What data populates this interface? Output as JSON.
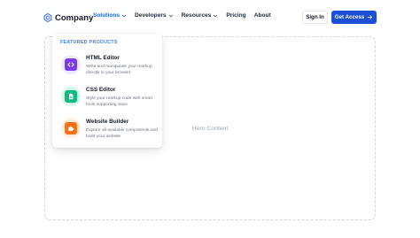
{
  "brand": {
    "name": "Company",
    "accent": "#2563eb"
  },
  "nav": {
    "items": [
      {
        "label": "Solutions",
        "has_dropdown": true,
        "active": true
      },
      {
        "label": "Developers",
        "has_dropdown": true,
        "active": false
      },
      {
        "label": "Resources",
        "has_dropdown": true,
        "active": false
      },
      {
        "label": "Pricing",
        "has_dropdown": false,
        "active": false
      },
      {
        "label": "About",
        "has_dropdown": false,
        "active": false
      }
    ],
    "sign_in": "Sign In",
    "cta": {
      "label": "Get Access",
      "icon": "arrow-right-icon",
      "color": "#1d4ed8"
    }
  },
  "dropdown": {
    "heading": "FEATURED PRODUCTS",
    "products": [
      {
        "title": "HTML Editor",
        "description": "Write and manipulate your markup directly in your browser",
        "icon": "code-icon",
        "color": "#7c3aed",
        "ring": "#ede9fe"
      },
      {
        "title": "CSS Editor",
        "description": "Style your markup code with smart tools supporting Sass",
        "icon": "file-icon",
        "color": "#10b981",
        "ring": "#d1fae5"
      },
      {
        "title": "Website Builder",
        "description": "Explore all available components and build your website",
        "icon": "puzzle-icon",
        "color": "#f97316",
        "ring": "#ffedd5"
      }
    ]
  },
  "hero": {
    "placeholder": "Hero Content"
  }
}
